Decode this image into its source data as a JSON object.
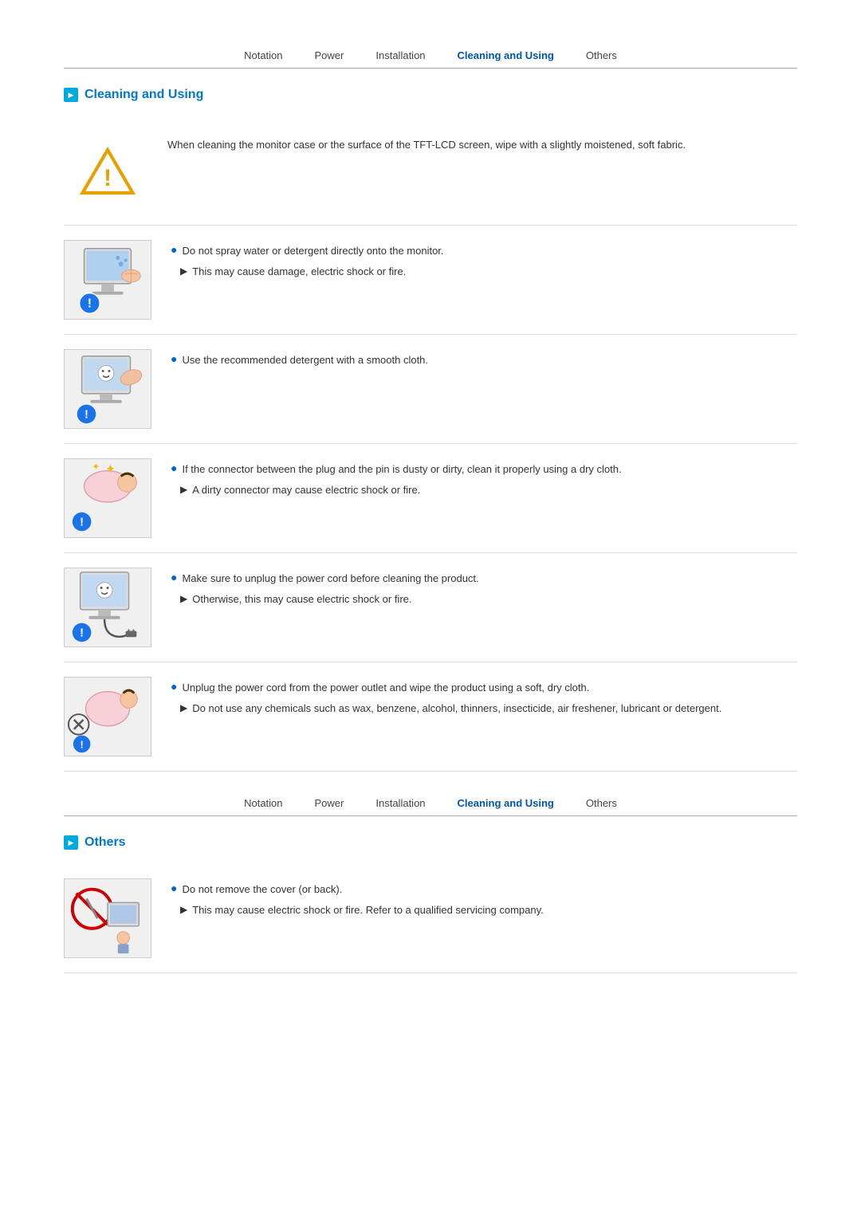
{
  "nav": {
    "notation": "Notation",
    "power": "Power",
    "installation": "Installation",
    "cleaning": "Cleaning and Using",
    "others": "Others"
  },
  "sections": {
    "cleaning": {
      "title": "Cleaning and Using",
      "intro": "When cleaning the monitor case or the surface of the TFT-LCD screen, wipe with a slightly moistened, soft fabric.",
      "items": [
        {
          "text": "Do not spray water or detergent directly onto the monitor.",
          "sub": "This may cause damage, electric shock or fire."
        },
        {
          "text": "Use the recommended detergent with a smooth cloth.",
          "sub": null
        },
        {
          "text": "If the connector between the plug and the pin is dusty or dirty, clean it properly using a dry cloth.",
          "sub": "A dirty connector may cause electric shock or fire."
        },
        {
          "text": "Make sure to unplug the power cord before cleaning the product.",
          "sub": "Otherwise, this may cause electric shock or fire."
        },
        {
          "text": "Unplug the power cord from the power outlet and wipe the product using a soft, dry cloth.",
          "sub": "Do not use any chemicals such as wax, benzene, alcohol, thinners, insecticide, air freshener, lubricant or detergent."
        }
      ]
    },
    "others": {
      "title": "Others",
      "items": [
        {
          "text": "Do not remove the cover (or back).",
          "sub": "This may cause electric shock or fire.\nRefer to a qualified servicing company."
        }
      ]
    }
  }
}
